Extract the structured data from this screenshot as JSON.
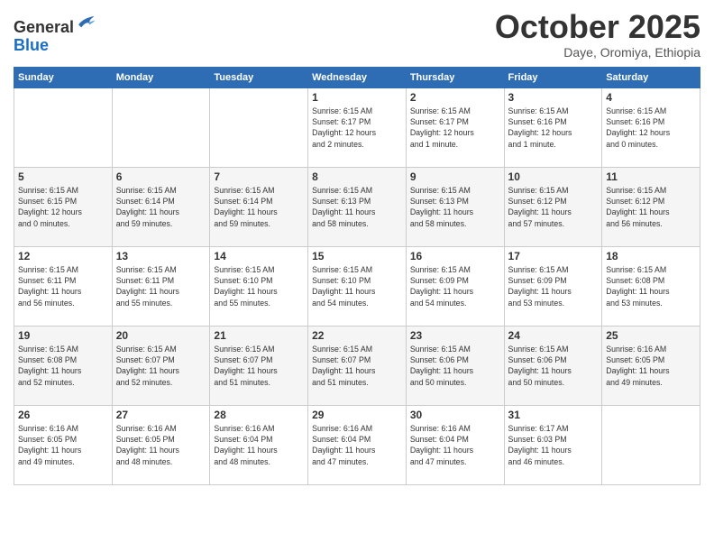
{
  "header": {
    "logo_general": "General",
    "logo_blue": "Blue",
    "month": "October 2025",
    "location": "Daye, Oromiya, Ethiopia"
  },
  "days_of_week": [
    "Sunday",
    "Monday",
    "Tuesday",
    "Wednesday",
    "Thursday",
    "Friday",
    "Saturday"
  ],
  "weeks": [
    [
      {
        "day": "",
        "info": ""
      },
      {
        "day": "",
        "info": ""
      },
      {
        "day": "",
        "info": ""
      },
      {
        "day": "1",
        "info": "Sunrise: 6:15 AM\nSunset: 6:17 PM\nDaylight: 12 hours\nand 2 minutes."
      },
      {
        "day": "2",
        "info": "Sunrise: 6:15 AM\nSunset: 6:17 PM\nDaylight: 12 hours\nand 1 minute."
      },
      {
        "day": "3",
        "info": "Sunrise: 6:15 AM\nSunset: 6:16 PM\nDaylight: 12 hours\nand 1 minute."
      },
      {
        "day": "4",
        "info": "Sunrise: 6:15 AM\nSunset: 6:16 PM\nDaylight: 12 hours\nand 0 minutes."
      }
    ],
    [
      {
        "day": "5",
        "info": "Sunrise: 6:15 AM\nSunset: 6:15 PM\nDaylight: 12 hours\nand 0 minutes."
      },
      {
        "day": "6",
        "info": "Sunrise: 6:15 AM\nSunset: 6:14 PM\nDaylight: 11 hours\nand 59 minutes."
      },
      {
        "day": "7",
        "info": "Sunrise: 6:15 AM\nSunset: 6:14 PM\nDaylight: 11 hours\nand 59 minutes."
      },
      {
        "day": "8",
        "info": "Sunrise: 6:15 AM\nSunset: 6:13 PM\nDaylight: 11 hours\nand 58 minutes."
      },
      {
        "day": "9",
        "info": "Sunrise: 6:15 AM\nSunset: 6:13 PM\nDaylight: 11 hours\nand 58 minutes."
      },
      {
        "day": "10",
        "info": "Sunrise: 6:15 AM\nSunset: 6:12 PM\nDaylight: 11 hours\nand 57 minutes."
      },
      {
        "day": "11",
        "info": "Sunrise: 6:15 AM\nSunset: 6:12 PM\nDaylight: 11 hours\nand 56 minutes."
      }
    ],
    [
      {
        "day": "12",
        "info": "Sunrise: 6:15 AM\nSunset: 6:11 PM\nDaylight: 11 hours\nand 56 minutes."
      },
      {
        "day": "13",
        "info": "Sunrise: 6:15 AM\nSunset: 6:11 PM\nDaylight: 11 hours\nand 55 minutes."
      },
      {
        "day": "14",
        "info": "Sunrise: 6:15 AM\nSunset: 6:10 PM\nDaylight: 11 hours\nand 55 minutes."
      },
      {
        "day": "15",
        "info": "Sunrise: 6:15 AM\nSunset: 6:10 PM\nDaylight: 11 hours\nand 54 minutes."
      },
      {
        "day": "16",
        "info": "Sunrise: 6:15 AM\nSunset: 6:09 PM\nDaylight: 11 hours\nand 54 minutes."
      },
      {
        "day": "17",
        "info": "Sunrise: 6:15 AM\nSunset: 6:09 PM\nDaylight: 11 hours\nand 53 minutes."
      },
      {
        "day": "18",
        "info": "Sunrise: 6:15 AM\nSunset: 6:08 PM\nDaylight: 11 hours\nand 53 minutes."
      }
    ],
    [
      {
        "day": "19",
        "info": "Sunrise: 6:15 AM\nSunset: 6:08 PM\nDaylight: 11 hours\nand 52 minutes."
      },
      {
        "day": "20",
        "info": "Sunrise: 6:15 AM\nSunset: 6:07 PM\nDaylight: 11 hours\nand 52 minutes."
      },
      {
        "day": "21",
        "info": "Sunrise: 6:15 AM\nSunset: 6:07 PM\nDaylight: 11 hours\nand 51 minutes."
      },
      {
        "day": "22",
        "info": "Sunrise: 6:15 AM\nSunset: 6:07 PM\nDaylight: 11 hours\nand 51 minutes."
      },
      {
        "day": "23",
        "info": "Sunrise: 6:15 AM\nSunset: 6:06 PM\nDaylight: 11 hours\nand 50 minutes."
      },
      {
        "day": "24",
        "info": "Sunrise: 6:15 AM\nSunset: 6:06 PM\nDaylight: 11 hours\nand 50 minutes."
      },
      {
        "day": "25",
        "info": "Sunrise: 6:16 AM\nSunset: 6:05 PM\nDaylight: 11 hours\nand 49 minutes."
      }
    ],
    [
      {
        "day": "26",
        "info": "Sunrise: 6:16 AM\nSunset: 6:05 PM\nDaylight: 11 hours\nand 49 minutes."
      },
      {
        "day": "27",
        "info": "Sunrise: 6:16 AM\nSunset: 6:05 PM\nDaylight: 11 hours\nand 48 minutes."
      },
      {
        "day": "28",
        "info": "Sunrise: 6:16 AM\nSunset: 6:04 PM\nDaylight: 11 hours\nand 48 minutes."
      },
      {
        "day": "29",
        "info": "Sunrise: 6:16 AM\nSunset: 6:04 PM\nDaylight: 11 hours\nand 47 minutes."
      },
      {
        "day": "30",
        "info": "Sunrise: 6:16 AM\nSunset: 6:04 PM\nDaylight: 11 hours\nand 47 minutes."
      },
      {
        "day": "31",
        "info": "Sunrise: 6:17 AM\nSunset: 6:03 PM\nDaylight: 11 hours\nand 46 minutes."
      },
      {
        "day": "",
        "info": ""
      }
    ]
  ]
}
